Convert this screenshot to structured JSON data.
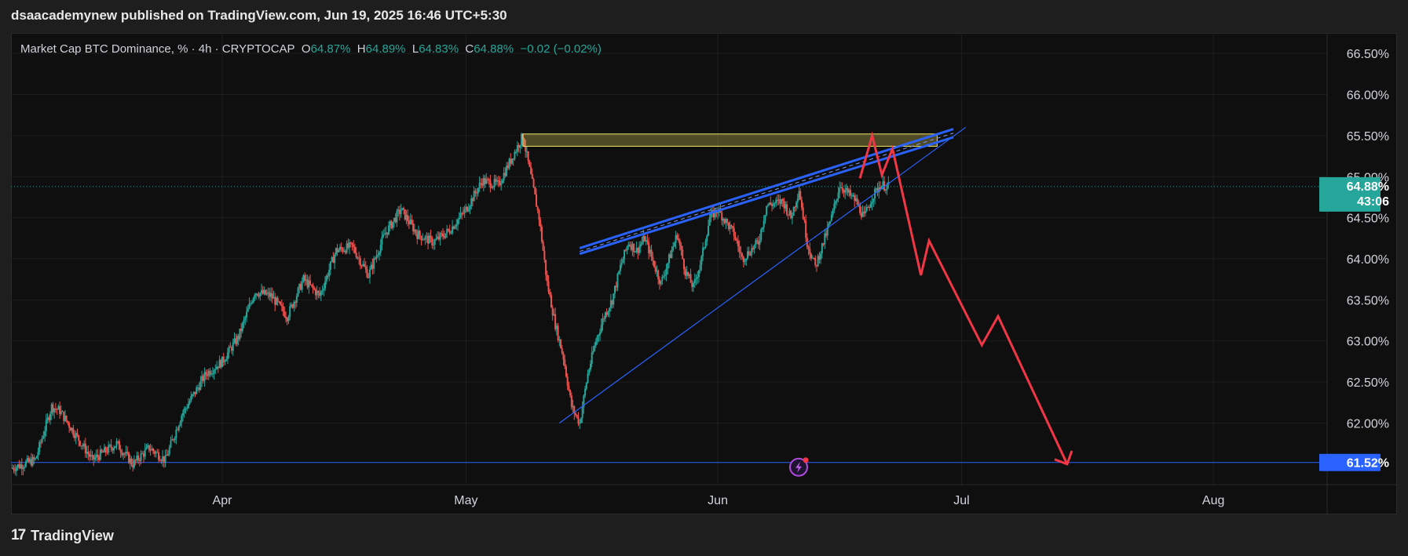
{
  "header": {
    "publisher_line": "dsaacademynew published on TradingView.com, Jun 19, 2025 16:46 UTC+5:30"
  },
  "legend": {
    "symbol": "Market Cap BTC Dominance, % · 4h · CRYPTOCAP",
    "o_label": "O",
    "o_value": "64.87%",
    "h_label": "H",
    "h_value": "64.89%",
    "l_label": "L",
    "l_value": "64.83%",
    "c_label": "C",
    "c_value": "64.88%",
    "change": "−0.02 (−0.02%)"
  },
  "price_badge": {
    "price": "64.88%",
    "countdown": "43:06"
  },
  "target_badge": {
    "price": "61.52%"
  },
  "footer": {
    "brand": "TradingView",
    "logo_glyph": "17"
  },
  "colors": {
    "up": "#26a69a",
    "down": "#ef5350",
    "accent_blue": "#2962ff",
    "zone": "#f5e663",
    "projection": "#f23645",
    "bg": "#0f0f0f"
  },
  "chart_data": {
    "type": "candlestick",
    "title": "Market Cap BTC Dominance, % · 4h · CRYPTOCAP",
    "ylim": [
      61.25,
      66.75
    ],
    "y_ticks": [
      "66.50%",
      "66.00%",
      "65.50%",
      "65.00%",
      "64.50%",
      "64.00%",
      "63.50%",
      "63.00%",
      "62.50%",
      "62.00%"
    ],
    "y_tick_values": [
      66.5,
      66.0,
      65.5,
      65.0,
      64.5,
      64.0,
      63.5,
      63.0,
      62.5,
      62.0
    ],
    "x_ticks": [
      "Apr",
      "May",
      "Jun",
      "Jul",
      "Aug"
    ],
    "x_tick_days": [
      26,
      56,
      87,
      117,
      148
    ],
    "x_day_range": [
      0,
      162
    ],
    "grid": true,
    "price_path": [
      [
        0,
        61.45
      ],
      [
        3,
        61.55
      ],
      [
        5,
        62.2
      ],
      [
        6,
        62.15
      ],
      [
        8,
        61.85
      ],
      [
        10,
        61.55
      ],
      [
        13,
        61.75
      ],
      [
        15,
        61.5
      ],
      [
        17,
        61.7
      ],
      [
        19,
        61.55
      ],
      [
        21,
        62.1
      ],
      [
        24,
        62.6
      ],
      [
        26,
        62.75
      ],
      [
        28,
        63.05
      ],
      [
        30,
        63.6
      ],
      [
        32,
        63.55
      ],
      [
        34,
        63.3
      ],
      [
        36,
        63.75
      ],
      [
        38,
        63.55
      ],
      [
        40,
        64.1
      ],
      [
        42,
        64.15
      ],
      [
        44,
        63.8
      ],
      [
        46,
        64.3
      ],
      [
        48,
        64.6
      ],
      [
        50,
        64.3
      ],
      [
        52,
        64.2
      ],
      [
        54,
        64.35
      ],
      [
        56,
        64.6
      ],
      [
        58,
        64.95
      ],
      [
        60,
        64.9
      ],
      [
        62,
        65.3
      ],
      [
        63,
        65.5
      ],
      [
        64,
        65.0
      ],
      [
        65,
        64.5
      ],
      [
        66,
        63.7
      ],
      [
        67,
        63.2
      ],
      [
        68,
        62.8
      ],
      [
        69,
        62.2
      ],
      [
        70,
        62.0
      ],
      [
        71,
        62.6
      ],
      [
        72,
        63.0
      ],
      [
        73,
        63.3
      ],
      [
        74,
        63.5
      ],
      [
        75,
        63.9
      ],
      [
        76,
        64.2
      ],
      [
        77,
        64.1
      ],
      [
        78,
        64.25
      ],
      [
        80,
        63.7
      ],
      [
        82,
        64.3
      ],
      [
        83,
        63.85
      ],
      [
        84,
        63.65
      ],
      [
        85,
        64.0
      ],
      [
        86,
        64.5
      ],
      [
        87,
        64.6
      ],
      [
        89,
        64.3
      ],
      [
        90,
        64.0
      ],
      [
        92,
        64.2
      ],
      [
        93,
        64.65
      ],
      [
        95,
        64.7
      ],
      [
        96,
        64.5
      ],
      [
        97,
        64.85
      ],
      [
        98,
        64.2
      ],
      [
        99,
        63.9
      ],
      [
        100,
        64.2
      ],
      [
        101,
        64.5
      ],
      [
        102,
        64.9
      ],
      [
        104,
        64.7
      ],
      [
        105,
        64.5
      ],
      [
        106,
        64.75
      ],
      [
        107,
        64.9
      ],
      [
        108,
        64.88
      ]
    ],
    "resistance_zone": {
      "from_day": 63,
      "to_day": 114,
      "low": 65.37,
      "high": 65.52
    },
    "channel_upper": [
      [
        70,
        64.13
      ],
      [
        116,
        65.58
      ]
    ],
    "channel_mid": [
      [
        70,
        64.09
      ],
      [
        116,
        65.53
      ]
    ],
    "channel_lower": [
      [
        70,
        64.06
      ],
      [
        116,
        65.48
      ]
    ],
    "support_line": [
      [
        67.5,
        62.0
      ],
      [
        117.5,
        65.6
      ]
    ],
    "target_level": 61.52,
    "projection": [
      [
        104.5,
        64.98
      ],
      [
        106,
        65.5
      ],
      [
        107.2,
        65.02
      ],
      [
        108.5,
        65.34
      ],
      [
        112,
        63.8
      ],
      [
        113,
        64.22
      ],
      [
        119.5,
        62.95
      ],
      [
        121.5,
        63.3
      ],
      [
        130,
        61.5
      ]
    ],
    "projection_arrow_tip": [
      130,
      61.5
    ]
  }
}
